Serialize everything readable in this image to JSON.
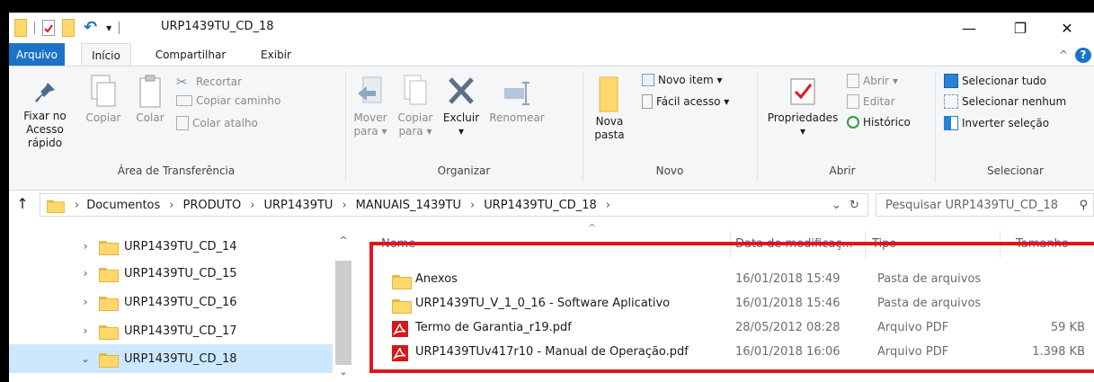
{
  "window": {
    "title": "URP1439TU_CD_18",
    "qa_dropdown": "▾",
    "min": "—",
    "restore": "❐",
    "close": "✕"
  },
  "tabs": {
    "file": "Arquivo",
    "home": "Início",
    "share": "Compartilhar",
    "view": "Exibir",
    "collapse": "^",
    "help": "?"
  },
  "ribbon": {
    "clipboard": {
      "label": "Área de Transferência",
      "pin_line1": "Fixar no",
      "pin_line2": "Acesso rápido",
      "copy": "Copiar",
      "paste": "Colar",
      "cut": "Recortar",
      "copy_path": "Copiar caminho",
      "paste_shortcut": "Colar atalho"
    },
    "organize": {
      "label": "Organizar",
      "move_line1": "Mover",
      "move_line2": "para ▾",
      "copy_line1": "Copiar",
      "copy_line2": "para ▾",
      "delete_line1": "Excluir",
      "delete_line2": "▾",
      "rename": "Renomear"
    },
    "new": {
      "label": "Novo",
      "folder_line1": "Nova",
      "folder_line2": "pasta",
      "new_item": "Novo item ▾",
      "easy_access": "Fácil acesso ▾"
    },
    "open": {
      "label": "Abrir",
      "properties": "Propriedades",
      "properties_arrow": "▾",
      "open": "Abrir ▾",
      "edit": "Editar",
      "history": "Histórico"
    },
    "select": {
      "label": "Selecionar",
      "all": "Selecionar tudo",
      "none": "Selecionar nenhum",
      "invert": "Inverter seleção"
    }
  },
  "address": {
    "up": "↑",
    "sep": "›",
    "crumbs": [
      "Documentos",
      "PRODUTO",
      "URP1439TU",
      "MANUAIS_1439TU",
      "URP1439TU_CD_18"
    ],
    "history_dropdown": "⌄",
    "refresh": "↻",
    "search_placeholder": "Pesquisar URP1439TU_CD_18",
    "search_icon": "⚲"
  },
  "nav": {
    "scroll_up": "^",
    "scroll_down": "⌄",
    "items": [
      {
        "chev": "›",
        "label": "URP1439TU_CD_14"
      },
      {
        "chev": "›",
        "label": "URP1439TU_CD_15"
      },
      {
        "chev": "›",
        "label": "URP1439TU_CD_16"
      },
      {
        "chev": "›",
        "label": "URP1439TU_CD_17"
      },
      {
        "chev": "⌄",
        "label": "URP1439TU_CD_18"
      }
    ]
  },
  "list": {
    "sort_arrow": "^",
    "headers": {
      "name": "Nome",
      "date": "Data de modificaç...",
      "type": "Tipo",
      "size": "Tamanho"
    },
    "rows": [
      {
        "icon": "folder-icon",
        "name": "Anexos",
        "date": "16/01/2018 15:49",
        "type": "Pasta de arquivos",
        "size": ""
      },
      {
        "icon": "folder-icon",
        "name": "URP1439TU_V_1_0_16 - Software Aplicativo",
        "date": "16/01/2018 15:46",
        "type": "Pasta de arquivos",
        "size": ""
      },
      {
        "icon": "pdf-icon",
        "name": "Termo de Garantia_r19.pdf",
        "date": "28/05/2012 08:28",
        "type": "Arquivo PDF",
        "size": "59 KB"
      },
      {
        "icon": "pdf-icon",
        "name": "URP1439TUv417r10 - Manual de Operação.pdf",
        "date": "16/01/2018 16:06",
        "type": "Arquivo PDF",
        "size": "1.398 KB"
      }
    ]
  },
  "colors": {
    "accent": "#1a73c7",
    "selection": "#cce8ff",
    "highlight": "#e1141c"
  }
}
